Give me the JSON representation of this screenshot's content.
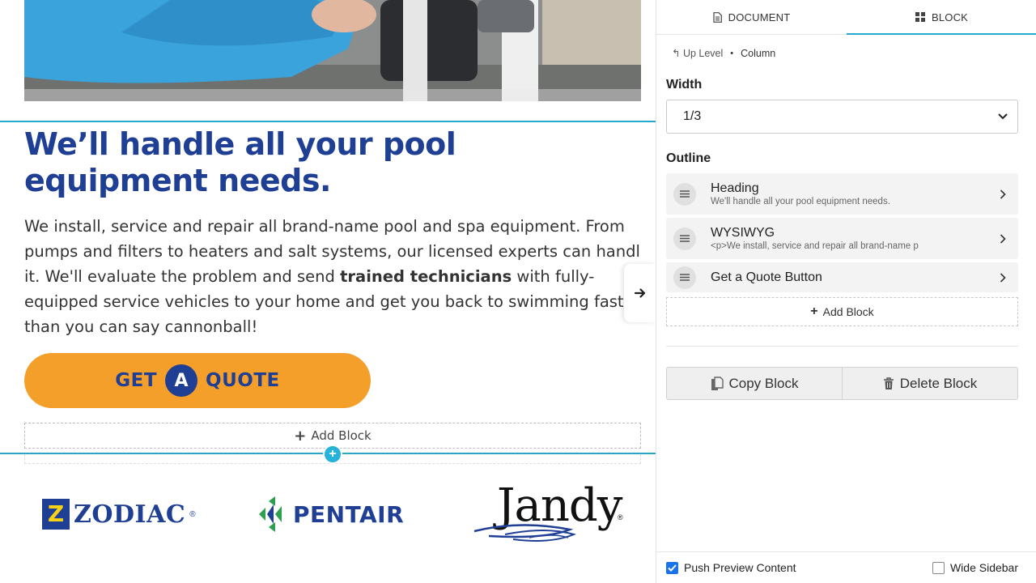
{
  "preview": {
    "headline": "We’ll handle all your pool equipment needs.",
    "body_lines": [
      [
        "We install, service and repair all brand-name pool and spa equipment. From"
      ],
      [
        "pumps and filters to heaters and salt systems, our licensed experts can handle"
      ],
      [
        "it. We'll evaluate the problem and send ",
        "trained technicians",
        " with fully-"
      ],
      [
        "equipped service vehicles to your home and get you back to swimming faster"
      ],
      [
        "than you can say cannonball!"
      ]
    ],
    "quote_button": {
      "get": "GET",
      "a": "A",
      "quote": "QUOTE"
    },
    "add_block": "Add Block",
    "logos": {
      "zodiac": "ZODIAC",
      "zodiac_small": "ZODIAC",
      "pentair": "PENTAIR",
      "jandy": "Jandy"
    },
    "colors": {
      "brand_blue": "#1f3f95",
      "button_orange": "#f59f2b",
      "accent_cyan": "#27a8c8"
    }
  },
  "sidebar": {
    "tabs": [
      {
        "label": "DOCUMENT",
        "icon": "document-icon",
        "active": false
      },
      {
        "label": "BLOCK",
        "icon": "block-grid-icon",
        "active": true
      }
    ],
    "breadcrumb": {
      "up": "Up Level",
      "current": "Column"
    },
    "width": {
      "label": "Width",
      "value": "1/3"
    },
    "outline": {
      "label": "Outline",
      "items": [
        {
          "title": "Heading",
          "subtitle": "We'll handle all your pool equipment needs."
        },
        {
          "title": "WYSIWYG",
          "subtitle": "<p>We install, service and repair all brand-name p"
        },
        {
          "title": "Get a Quote Button",
          "subtitle": ""
        }
      ]
    },
    "add_block": "Add Block",
    "copy_block": "Copy Block",
    "delete_block": "Delete Block",
    "footer": {
      "push_preview": {
        "label": "Push Preview Content",
        "checked": true
      },
      "wide_sidebar": {
        "label": "Wide Sidebar",
        "checked": false
      }
    }
  }
}
